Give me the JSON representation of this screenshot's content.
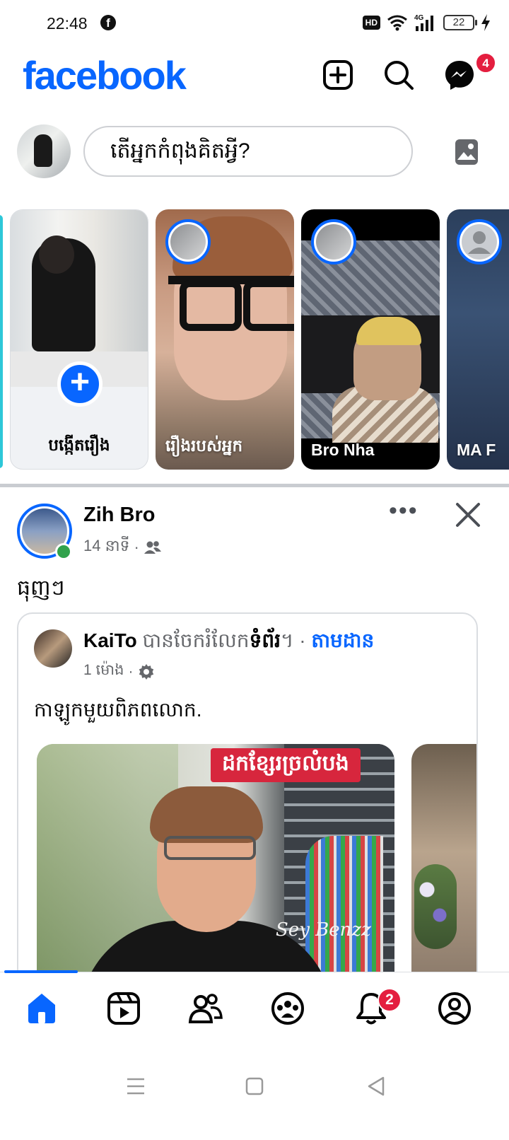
{
  "status_bar": {
    "time": "22:48",
    "battery": "22",
    "icons": [
      "facebook-notification-icon",
      "hd-icon",
      "wifi-icon",
      "4g-signal-icon",
      "battery-icon",
      "charging-icon"
    ],
    "hd_label": "HD"
  },
  "header": {
    "logo": "facebook",
    "messenger_badge": "4",
    "icons": [
      "create-post-icon",
      "search-icon",
      "messenger-icon"
    ],
    "brand_color": "#0866ff",
    "badge_color": "#e41e3f"
  },
  "composer": {
    "placeholder": "តើអ្នកកំពុងគិតអ្វី?",
    "photo_icon": "photo-icon"
  },
  "stories": [
    {
      "label": "បង្កើតរឿង",
      "type": "create"
    },
    {
      "label": "រឿងរបស់អ្នក",
      "type": "story"
    },
    {
      "label": "Bro Nha",
      "type": "story"
    },
    {
      "label": "MA F",
      "type": "story"
    }
  ],
  "post": {
    "author": "Zih Bro",
    "time": "14 នាទី",
    "separator": "·",
    "audience_icon": "friends-icon",
    "text": "ធុញៗ",
    "more_label": "•••",
    "shared": {
      "author": "KaiTo",
      "action": " បានចែករំលែក",
      "object": "ទំព័រ",
      "period": "។",
      "follow": "តាមដាន",
      "time": "1 ម៉ោង",
      "separator": "·",
      "privacy_icon": "settings-icon",
      "text": "កាឡូកមួយពិភពលោក.",
      "image_banner": "ដកខ្សែរច្រលំបង",
      "image_watermark": "Sey Benzz"
    }
  },
  "tabbar": {
    "tabs": [
      "home",
      "reels",
      "friends",
      "groups",
      "notifications",
      "profile"
    ],
    "active": "home",
    "notifications_badge": "2"
  },
  "system_nav": [
    "menu-button",
    "home-button",
    "back-button"
  ]
}
